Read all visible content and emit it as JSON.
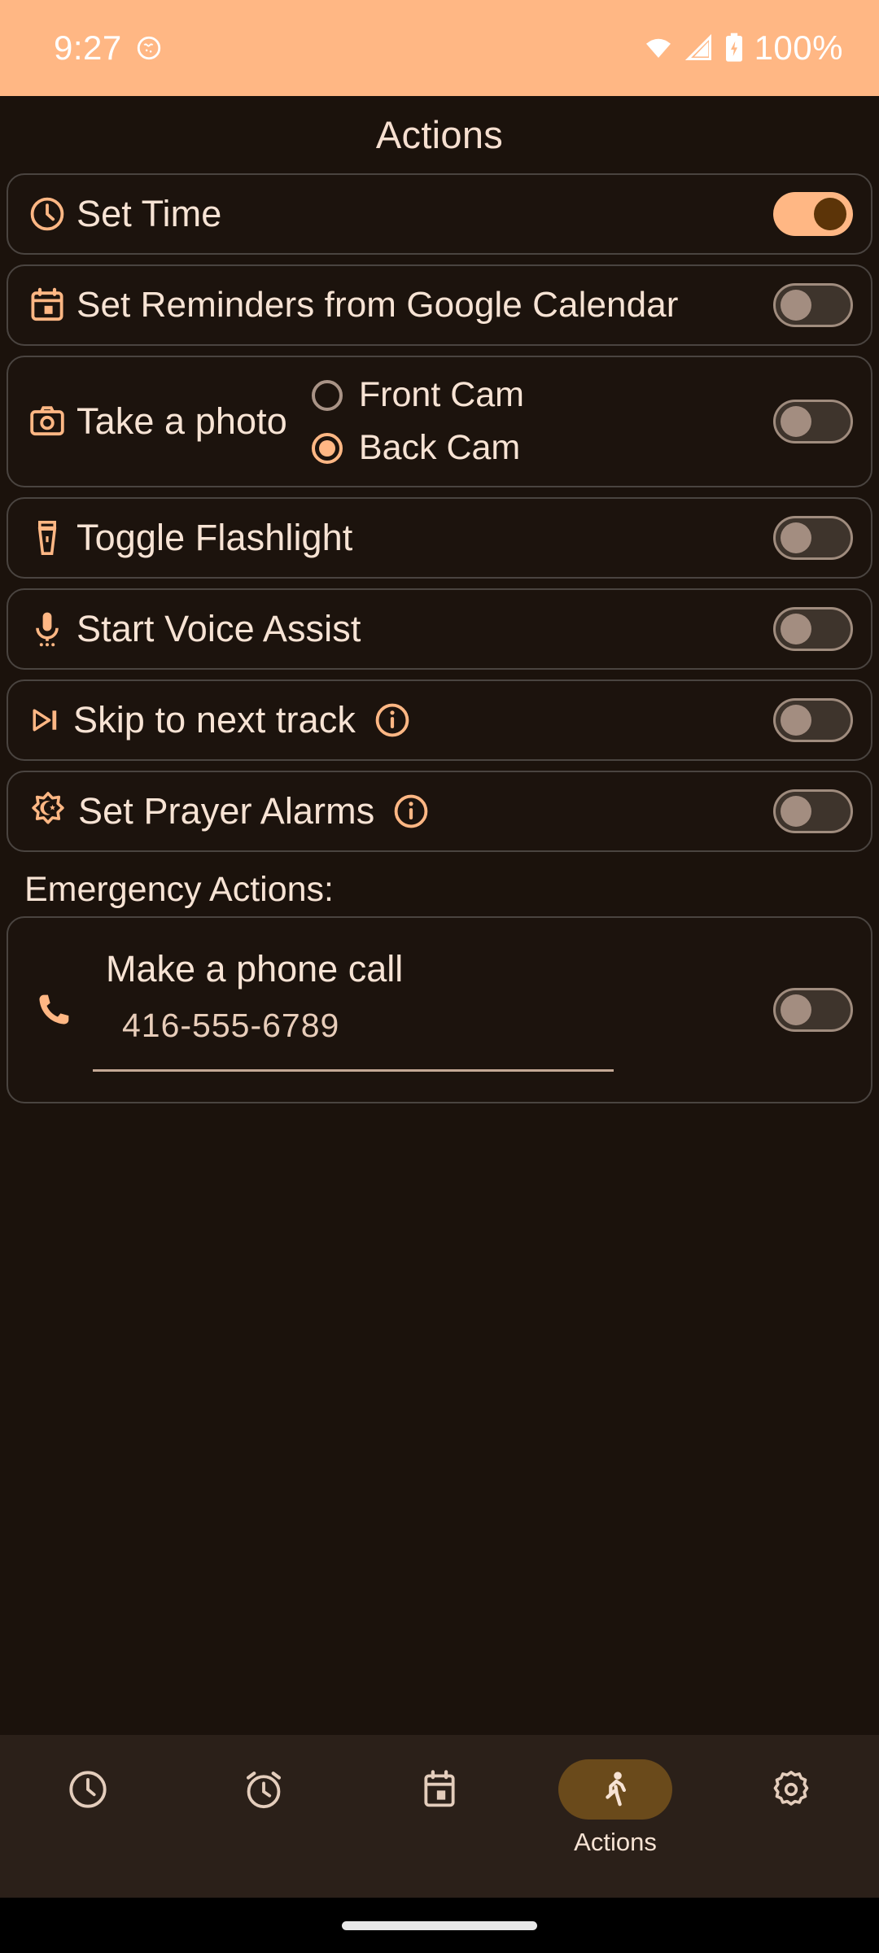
{
  "status_bar": {
    "time": "9:27",
    "dnd_icon": "do-not-disturb-icon",
    "wifi_icon": "wifi-icon",
    "signal_icon": "cell-signal-icon",
    "battery_icon": "battery-charging-icon",
    "battery_label": "100%",
    "background_color": "#FFB784",
    "text_color": "#FFFFFF"
  },
  "header": {
    "title": "Actions"
  },
  "theme": {
    "page_background": "#1B120C",
    "card_background": "#1C130D",
    "card_border": "#4A4440",
    "accent": "#FFB784",
    "text_primary": "#F7E3D4",
    "toggle_on_track": "#FFB784",
    "toggle_on_thumb": "#5C3408",
    "toggle_off_track": "#3E342C",
    "toggle_off_thumb": "#A38D80",
    "nav_background": "#2B2019",
    "nav_active_pill": "#6A4A1B"
  },
  "actions": [
    {
      "label": "Set Time",
      "icon": "clock-icon",
      "toggle": "on"
    },
    {
      "label": "Set Reminders from Google Calendar",
      "icon": "calendar-icon",
      "toggle": "off"
    },
    {
      "label": "Take a photo",
      "icon": "camera-icon",
      "toggle": "off",
      "options": [
        {
          "label": "Front Cam",
          "selected": false
        },
        {
          "label": "Back Cam",
          "selected": true
        }
      ]
    },
    {
      "label": "Toggle Flashlight",
      "icon": "flashlight-icon",
      "toggle": "off"
    },
    {
      "label": "Start Voice Assist",
      "icon": "microphone-icon",
      "toggle": "off"
    },
    {
      "label": "Skip to next track",
      "icon": "skip-next-icon",
      "info_icon": "info-icon",
      "toggle": "off"
    },
    {
      "label": "Set Prayer Alarms",
      "icon": "prayer-star-crescent-icon",
      "info_icon": "info-icon",
      "toggle": "off"
    }
  ],
  "emergency": {
    "section_label": "Emergency Actions:",
    "card": {
      "title": "Make a phone call",
      "icon": "phone-icon",
      "phone_number": "416-555-6789",
      "toggle": "off"
    }
  },
  "bottom_nav": {
    "items": [
      {
        "label": "",
        "icon": "clock-icon",
        "active": false
      },
      {
        "label": "",
        "icon": "alarm-icon",
        "active": false
      },
      {
        "label": "",
        "icon": "calendar-icon",
        "active": false
      },
      {
        "label": "Actions",
        "icon": "running-person-icon",
        "active": true
      },
      {
        "label": "",
        "icon": "gear-icon",
        "active": false
      }
    ]
  }
}
